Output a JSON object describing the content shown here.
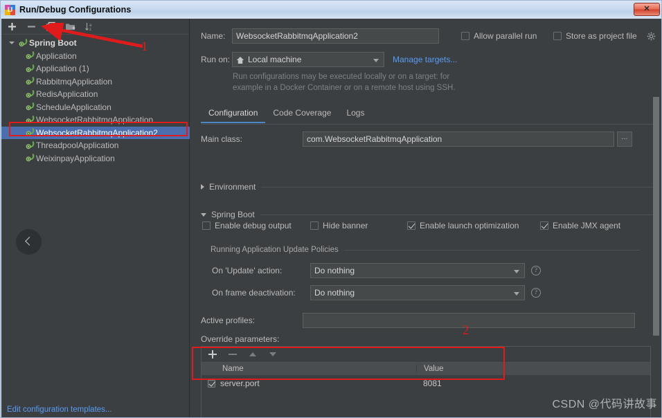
{
  "window": {
    "title": "Run/Debug Configurations",
    "close_label": "✕",
    "app_icon": "intellij-idea-icon"
  },
  "sidebar": {
    "toolbar": [
      {
        "name": "add-configuration-button",
        "icon": "plus-icon",
        "label": "+"
      },
      {
        "name": "remove-configuration-button",
        "icon": "minus-icon",
        "label": "−"
      },
      {
        "name": "copy-configuration-button",
        "icon": "copy-icon",
        "label": "Copy Configuration"
      },
      {
        "name": "move-into-folder-button",
        "icon": "folder-add-icon",
        "label": "Move into new folder"
      },
      {
        "name": "sort-configurations-button",
        "icon": "sort-alpha-icon",
        "label": "Sort configurations"
      }
    ],
    "tree": {
      "root": {
        "label": "Spring Boot",
        "expanded": true,
        "icon": "spring-boot-icon"
      },
      "items": [
        {
          "label": "Application",
          "icon": "spring-boot-icon",
          "selected": false
        },
        {
          "label": "Application (1)",
          "icon": "spring-boot-icon",
          "selected": false
        },
        {
          "label": "RabbitmqApplication",
          "icon": "spring-boot-icon",
          "selected": false
        },
        {
          "label": "RedisApplication",
          "icon": "spring-boot-icon",
          "selected": false
        },
        {
          "label": "ScheduleApplication",
          "icon": "spring-boot-icon",
          "selected": false
        },
        {
          "label": "WebsocketRabbitmqApplication",
          "icon": "spring-boot-icon",
          "selected": false
        },
        {
          "label": "WebsocketRabbitmqApplication2",
          "icon": "spring-boot-icon",
          "selected": true
        },
        {
          "label": "ThreadpoolApplication",
          "icon": "spring-boot-icon",
          "selected": false
        },
        {
          "label": "WeixinpayApplication",
          "icon": "spring-boot-icon",
          "selected": false
        }
      ]
    },
    "collapse_button": "chevron-left-icon",
    "edit_templates_link": "Edit configuration templates..."
  },
  "form": {
    "name_label": "Name:",
    "name_value": "WebsocketRabbitmqApplication2",
    "allow_parallel_run": {
      "label": "Allow parallel run",
      "checked": false
    },
    "store_as_project_file": {
      "label": "Store as project file",
      "checked": false
    },
    "run_on_label": "Run on:",
    "run_on_value": "Local machine",
    "manage_targets_link": "Manage targets...",
    "run_on_hint_line1": "Run configurations may be executed locally or on a target: for",
    "run_on_hint_line2": "example in a Docker Container or on a remote host using SSH."
  },
  "tabs": [
    {
      "label": "Configuration",
      "active": true
    },
    {
      "label": "Code Coverage",
      "active": false
    },
    {
      "label": "Logs",
      "active": false
    }
  ],
  "configuration": {
    "main_class_label": "Main class:",
    "main_class_value": "com.WebsocketRabbitmqApplication",
    "browse_button_label": "...",
    "environment_section": {
      "label": "Environment",
      "expanded": false
    },
    "spring_boot_section": {
      "label": "Spring Boot",
      "expanded": true
    },
    "spring_boot_checks": [
      {
        "label": "Enable debug output",
        "checked": false
      },
      {
        "label": "Hide banner",
        "checked": false
      },
      {
        "label": "Enable launch optimization",
        "checked": true
      },
      {
        "label": "Enable JMX agent",
        "checked": true
      }
    ],
    "running_update_policies_label": "Running Application Update Policies",
    "policies": [
      {
        "label": "On 'Update' action:",
        "value": "Do nothing",
        "help": "help-icon"
      },
      {
        "label": "On frame deactivation:",
        "value": "Do nothing",
        "help": "help-icon"
      }
    ],
    "active_profiles_label": "Active profiles:",
    "active_profiles_value": "",
    "override_parameters_label": "Override parameters:",
    "override_toolbar": [
      {
        "name": "add-parameter-button",
        "icon": "plus-icon"
      },
      {
        "name": "remove-parameter-button",
        "icon": "minus-icon"
      },
      {
        "name": "move-up-button",
        "icon": "arrow-up-icon"
      },
      {
        "name": "move-down-button",
        "icon": "arrow-down-icon"
      }
    ],
    "override_table": {
      "columns": [
        "Name",
        "Value"
      ],
      "rows": [
        {
          "enabled": true,
          "name": "server.port",
          "value": "8081"
        }
      ]
    }
  },
  "annotations": {
    "marker_1": "1",
    "marker_2": "2"
  },
  "watermark": "CSDN @代码讲故事",
  "colors": {
    "accent_blue": "#4a88c7",
    "link_blue": "#589df6",
    "selection_blue": "#4b6eaf",
    "panel_bg": "#3c3f41",
    "field_bg": "#45494a",
    "annotation_red": "#e01b1b",
    "spring_green": "#6aa84f"
  }
}
